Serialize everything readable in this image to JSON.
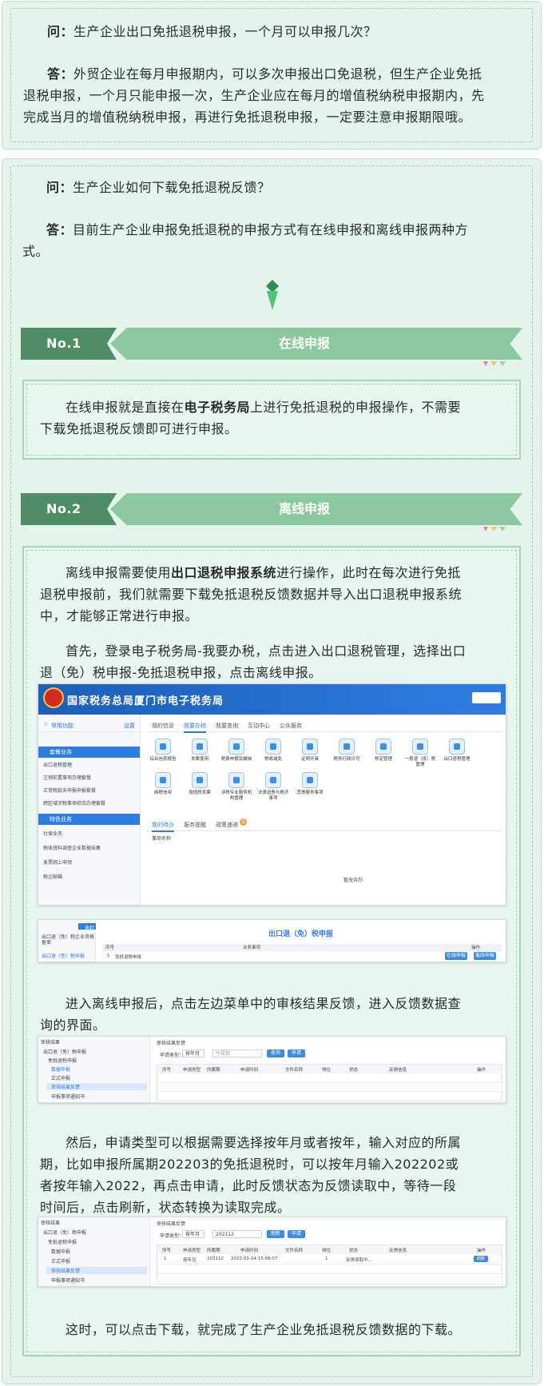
{
  "card1": {
    "q_label": "问：",
    "q_text": "生产企业出口免抵退税申报，一个月可以申报几次？",
    "a_label": "答：",
    "a_lines": [
      "外贸企业在每月申报期内，可以多次申报出口免退税，但生产企业免抵",
      "退税申报，一个月只能申报一次，生产企业应在每月的增值税纳税申报期内，先",
      "完成当月的增值税纳税申报，再进行免抵退税申报，一定要注意申报期限哦。"
    ]
  },
  "card2": {
    "q_label": "问：",
    "q_text": "生产企业如何下载免抵退税反馈？",
    "a_label": "答：",
    "a_lines": [
      "目前生产企业申报免抵退税的申报方式有在线申报和离线申报两种方",
      "式。"
    ]
  },
  "section1": {
    "no": "No.1",
    "title": "在线申报",
    "lines_pre": "在线申报就是直接在",
    "lines_bold": "电子税务局",
    "lines_post": "上进行免抵退税的申报操作，不需要",
    "line2": "下载免抵退税反馈即可进行申报。"
  },
  "section2": {
    "no": "No.2",
    "title": "离线申报",
    "p1_pre": "离线申报需要使用",
    "p1_bold": "出口退税申报系统",
    "p1_post": "进行操作，此时在每次进行免抵",
    "p1_l2": "退税申报前，我们就需要下载免抵退税反馈数据并导入出口退税申报系统",
    "p1_l3": "中，才能够正常进行申报。",
    "p2_l1": "首先，登录电子税务局-我要办税，点击进入出口退税管理，选择出口",
    "p2_l2": "退（免）税申报-免抵退税申报，点击离线申报。",
    "p3_l1": "进入离线申报后，点击左边菜单中的审核结果反馈，进入反馈数据查",
    "p3_l2": "询的界面。",
    "p4_l1": "然后，申请类型可以根据需要选择按年月或者按年，输入对应的所属",
    "p4_l2": "期，比如申报所属期202203的免抵退税时，可以按年月输入202202或",
    "p4_l3": "者按年输入2022，再点击申请，此时反馈状态为反馈读取中，等待一段",
    "p4_l4": "时间后，点击刷新，状态转换为读取完成。",
    "p5": "这时，可以点击下载，就完成了生产企业免抵退税反馈数据的下载。"
  },
  "shot1": {
    "title": "国家税务总局厦门市电子税务局",
    "side_header": "常用功能",
    "side_settings": "设置",
    "side_cat1": "套餐业务",
    "side_items1": [
      "出口退税管理",
      "注销前置事项办理套餐",
      "正常税款未申报申报套餐",
      "跨区域涉税事项综合办理套餐"
    ],
    "side_cat2": "特色业务",
    "side_items2": [
      "社保业务",
      "税收资料调查企业数据采集",
      "发票网上申领",
      "税企邮箱"
    ],
    "tabs": [
      "我的信息",
      "我要办税",
      "我要查询",
      "互动中心",
      "公众服务"
    ],
    "apps_row1": [
      "综合信息报告",
      "发票使用",
      "税费申报及缴纳",
      "税收减免",
      "证明开具",
      "税务行政许可",
      "核定管理",
      "一般退（抵）税管理",
      "出口退税管理"
    ],
    "apps_row2": [
      "纳税信用",
      "增值税发票",
      "涉税专业服务机构管理",
      "法律追责与救济事项",
      "其他服务事项"
    ],
    "lower_tabs": [
      "我的待办",
      "服务提醒",
      "政策速递"
    ],
    "lower_badge": "2",
    "col_header": "事项名称",
    "empty": "暂无待办"
  },
  "shot2": {
    "side_l1": "出口退（免）税企业资格备案",
    "side_l2": "出口退（免）税申报",
    "collapse": "收起",
    "title": "出口退（免）税申报",
    "col1": "序号",
    "col2": "业务事项",
    "col3": "操作",
    "row_no": "1",
    "row_item": "免抵退税申报",
    "btn1": "在线申报",
    "btn2": "离线申报"
  },
  "shot3": {
    "menu_title": "审核结果",
    "menu_items": [
      "出口退（免）税申报",
      "免抵退税申报",
      "数据申报",
      "正式申报",
      "审核结果反馈",
      "申报事项通知书"
    ],
    "panel_title": "审核结果反馈",
    "query_label": "申请类型：",
    "query_select": "按年月",
    "query_placeholder": "所属期",
    "btn_query": "查询",
    "btn_apply": "申请",
    "cols": [
      "序号",
      "申请类型",
      "所属期",
      "申请时间",
      "文件名称",
      "排位",
      "状态",
      "反馈信息",
      "操作"
    ]
  },
  "shot4": {
    "menu_title": "审核结果",
    "menu_items": [
      "出口退（免）税申报",
      "免抵退税申报",
      "数据申报",
      "正式申报",
      "审核结果反馈",
      "申报事项通知书"
    ],
    "panel_title": "审核结果反馈",
    "query_label": "申请类型：",
    "query_select": "按年月",
    "query_value": "202112",
    "btn_query": "刷新",
    "btn_apply": "申请",
    "cols": [
      "序号",
      "申请类型",
      "所属期",
      "申请时间",
      "文件名称",
      "排位",
      "状态",
      "反馈信息",
      "操作"
    ],
    "row": [
      "1",
      "按年月",
      "202112",
      "2022-01-24 15:08:07",
      "",
      "1",
      "反馈读取中...",
      "",
      "刷新"
    ]
  },
  "colors": {
    "card_bg": "#e4f3ec",
    "banner_dark": "#4f8d67",
    "banner_light": "#8bc89f",
    "frame": "#a8d6b8",
    "header_blue": "#2e7de0"
  }
}
